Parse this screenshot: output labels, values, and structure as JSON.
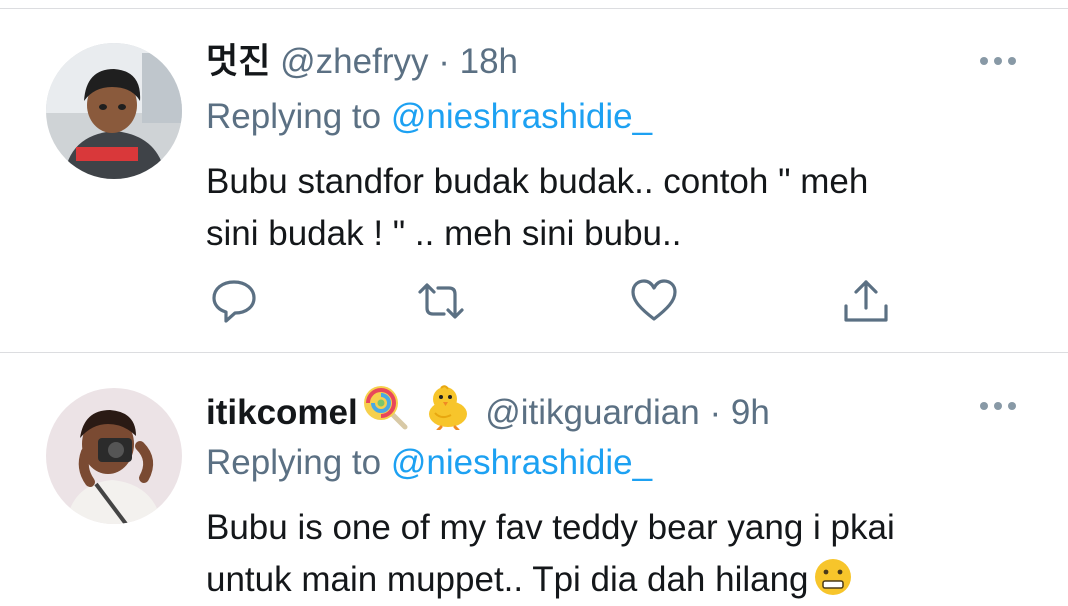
{
  "tweets": [
    {
      "display_name": "멋진",
      "handle": "@zhefryy",
      "dot": "·",
      "time": "18h",
      "reply_prefix": "Replying to",
      "reply_to": "@nieshrashidie_",
      "body_line1": "Bubu standfor budak budak.. contoh \" meh",
      "body_line2": "sini budak ! \" .. meh sini bubu..",
      "name_emojis": []
    },
    {
      "display_name": "itikcomel",
      "handle": "@itikguardian",
      "dot": "·",
      "time": "9h",
      "reply_prefix": "Replying to",
      "reply_to": "@nieshrashidie_",
      "body_line1": "Bubu is one of my fav teddy bear yang i pkai",
      "body_line2": "untuk main muppet.. Tpi dia dah hilang",
      "name_emojis": [
        "lollipop-icon",
        "baby-chick-icon"
      ]
    }
  ],
  "icons": {
    "reply": "speech-bubble-icon",
    "retweet": "retweet-icon",
    "like": "heart-icon",
    "share": "share-upload-icon",
    "more": "more-dots-icon",
    "body_emoji": "grimacing-face-icon"
  },
  "colors": {
    "text": "#14171a",
    "secondary": "#5b7083",
    "link": "#1da1f2",
    "divider": "#dcdde0"
  }
}
